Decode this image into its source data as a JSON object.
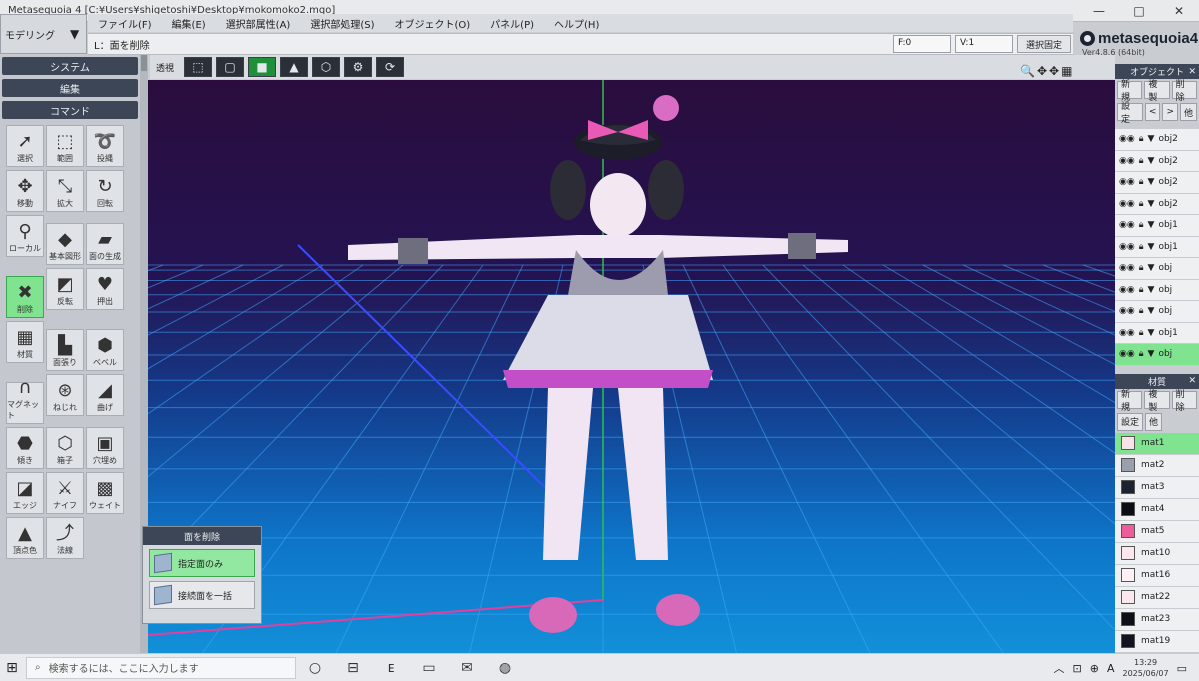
{
  "window": {
    "title": "Metasequoia 4 [C:¥Users¥shigetoshi¥Desktop¥mokomoko2.mqo]",
    "controls": [
      "—",
      "□",
      "✕"
    ]
  },
  "mode": {
    "label": "モデリング",
    "arrow": "▼"
  },
  "menu": [
    "ファイル(F)",
    "編集(E)",
    "選択部属性(A)",
    "選択部処理(S)",
    "オブジェクト(O)",
    "パネル(P)",
    "ヘルプ(H)"
  ],
  "status": {
    "hint": "L：面を削除",
    "faces": "F:0",
    "vertices": "V:1",
    "select_lock": "選択固定"
  },
  "logo": {
    "brand": "metasequoia4",
    "version": "Ver4.8.6 (64bit)"
  },
  "left_panel": {
    "system": "システム",
    "edit": "編集",
    "command": "コマンド",
    "tools": [
      {
        "label": "選択",
        "icon": "cursor-icon",
        "glyph": "➚"
      },
      {
        "label": "範囲",
        "icon": "rect-select-icon",
        "glyph": "⬚"
      },
      {
        "label": "投縄",
        "icon": "lasso-icon",
        "glyph": "➰"
      },
      {
        "label": "移動",
        "icon": "move-icon",
        "glyph": "✥"
      },
      {
        "label": "拡大",
        "icon": "scale-icon",
        "glyph": "⤡"
      },
      {
        "label": "回転",
        "icon": "rotate-icon",
        "glyph": "↻"
      },
      {
        "label": "ローカル",
        "icon": "local-axis-icon",
        "glyph": "⚲"
      },
      {
        "label": "基本図形",
        "icon": "primitive-icon",
        "glyph": "◆"
      },
      {
        "label": "面の生成",
        "icon": "create-face-icon",
        "glyph": "▰"
      },
      {
        "label": "削除",
        "icon": "delete-icon",
        "glyph": "✖"
      },
      {
        "label": "反転",
        "icon": "flip-icon",
        "glyph": "◩"
      },
      {
        "label": "押出",
        "icon": "extrude-icon",
        "glyph": "♥"
      },
      {
        "label": "材質",
        "icon": "material-icon",
        "glyph": "▦"
      },
      {
        "label": "面張り",
        "icon": "fill-face-icon",
        "glyph": "▙"
      },
      {
        "label": "ベベル",
        "icon": "bevel-icon",
        "glyph": "⬢"
      },
      {
        "label": "マグネット",
        "icon": "magnet-icon",
        "glyph": "∩"
      },
      {
        "label": "ねじれ",
        "icon": "twist-icon",
        "glyph": "⊛"
      },
      {
        "label": "曲げ",
        "icon": "bend-icon",
        "glyph": "◢"
      },
      {
        "label": "傾き",
        "icon": "tilt-icon",
        "glyph": "⬣"
      },
      {
        "label": "箱子",
        "icon": "box-icon",
        "glyph": "⬡"
      },
      {
        "label": "穴埋め",
        "icon": "hole-fill-icon",
        "glyph": "▣"
      },
      {
        "label": "エッジ",
        "icon": "edge-icon",
        "glyph": "◪"
      },
      {
        "label": "ナイフ",
        "icon": "knife-icon",
        "glyph": "⚔"
      },
      {
        "label": "ウェイト",
        "icon": "weight-icon",
        "glyph": "▩"
      },
      {
        "label": "頂点色",
        "icon": "vertex-color-icon",
        "glyph": "▲"
      },
      {
        "label": "法線",
        "icon": "normal-icon",
        "glyph": "⤴"
      }
    ]
  },
  "viewport": {
    "label": "透視",
    "buttons": [
      {
        "name": "wire-icon",
        "glyph": "⬚"
      },
      {
        "name": "hidden-wire-icon",
        "glyph": "▢"
      },
      {
        "name": "solid-icon",
        "glyph": "■"
      },
      {
        "name": "ortho-icon",
        "glyph": "▲"
      },
      {
        "name": "cube-view-icon",
        "glyph": "⬡"
      },
      {
        "name": "gear-icon",
        "glyph": "⚙"
      },
      {
        "name": "refresh-icon",
        "glyph": "⟳"
      }
    ],
    "nav": [
      "🔍",
      "✥",
      "✥",
      "▦"
    ]
  },
  "delete_popup": {
    "title": "面を削除",
    "options": [
      {
        "label": "指定面のみ",
        "active": true
      },
      {
        "label": "接続面を一括",
        "active": false
      }
    ]
  },
  "objects_panel": {
    "title": "オブジェクト",
    "buttons1": [
      "新規",
      "複製",
      "削除"
    ],
    "buttons2": [
      "設定",
      "<",
      ">",
      "他"
    ],
    "rows": [
      "obj2",
      "obj2",
      "obj2",
      "obj2",
      "obj1",
      "obj1",
      "obj",
      "obj",
      "obj",
      "obj1",
      "obj"
    ]
  },
  "materials_panel": {
    "title": "材質",
    "buttons1": [
      "新規",
      "複製",
      "削除"
    ],
    "buttons2": [
      "設定",
      "他"
    ],
    "rows": [
      {
        "name": "mat1",
        "color": "#f6e3e8"
      },
      {
        "name": "mat2",
        "color": "#9aa0ab"
      },
      {
        "name": "mat3",
        "color": "#1e2230"
      },
      {
        "name": "mat4",
        "color": "#0c0c14"
      },
      {
        "name": "mat5",
        "color": "#ef5c9b"
      },
      {
        "name": "mat10",
        "color": "#fbe6ee"
      },
      {
        "name": "mat16",
        "color": "#fff2f5"
      },
      {
        "name": "mat22",
        "color": "#fde7ef"
      },
      {
        "name": "mat23",
        "color": "#0f0f18"
      },
      {
        "name": "mat19",
        "color": "#141420"
      }
    ]
  },
  "taskbar": {
    "search_placeholder": "検索するには、ここに入力します",
    "apps": [
      {
        "name": "taskview-icon",
        "glyph": "○"
      },
      {
        "name": "widgets-icon",
        "glyph": "⊟"
      },
      {
        "name": "edge-browser-icon",
        "glyph": "ᴇ"
      },
      {
        "name": "file-explorer-icon",
        "glyph": "▭"
      },
      {
        "name": "mail-icon",
        "glyph": "✉"
      },
      {
        "name": "app-icon",
        "glyph": "◍"
      }
    ],
    "time": "13:29",
    "date": "2025/06/07"
  }
}
